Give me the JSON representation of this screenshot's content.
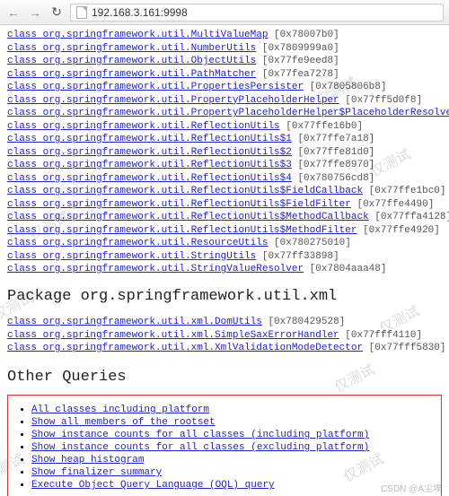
{
  "browser": {
    "url": "192.168.3.161:9998"
  },
  "classes": [
    {
      "name": "class org.springframework.util.MultiValueMap",
      "addr": "[0x78007b0]"
    },
    {
      "name": "class org.springframework.util.NumberUtils",
      "addr": "[0x7809999a0]"
    },
    {
      "name": "class org.springframework.util.ObjectUtils",
      "addr": "[0x77fe9eed8]"
    },
    {
      "name": "class org.springframework.util.PathMatcher",
      "addr": "[0x77fea7278]"
    },
    {
      "name": "class org.springframework.util.PropertiesPersister",
      "addr": "[0x7805806b8]"
    },
    {
      "name": "class org.springframework.util.PropertyPlaceholderHelper",
      "addr": "[0x77ff5d0f8]"
    },
    {
      "name": "class org.springframework.util.PropertyPlaceholderHelper$PlaceholderResolver",
      "addr": ""
    },
    {
      "name": "class org.springframework.util.ReflectionUtils",
      "addr": "[0x77ffe16b0]"
    },
    {
      "name": "class org.springframework.util.ReflectionUtils$1",
      "addr": "[0x77ffe7a18]"
    },
    {
      "name": "class org.springframework.util.ReflectionUtils$2",
      "addr": "[0x77ffe81d0]"
    },
    {
      "name": "class org.springframework.util.ReflectionUtils$3",
      "addr": "[0x77ffe8970]"
    },
    {
      "name": "class org.springframework.util.ReflectionUtils$4",
      "addr": "[0x780756cd8]"
    },
    {
      "name": "class org.springframework.util.ReflectionUtils$FieldCallback",
      "addr": "[0x77ffe1bc0]"
    },
    {
      "name": "class org.springframework.util.ReflectionUtils$FieldFilter",
      "addr": "[0x77ffe4490]"
    },
    {
      "name": "class org.springframework.util.ReflectionUtils$MethodCallback",
      "addr": "[0x77ffa4128]"
    },
    {
      "name": "class org.springframework.util.ReflectionUtils$MethodFilter",
      "addr": "[0x77ffe4920]"
    },
    {
      "name": "class org.springframework.util.ResourceUtils",
      "addr": "[0x780275010]"
    },
    {
      "name": "class org.springframework.util.StringUtils",
      "addr": "[0x77ff33898]"
    },
    {
      "name": "class org.springframework.util.StringValueResolver",
      "addr": "[0x7804aaa48]"
    }
  ],
  "package_xml": {
    "heading": "Package org.springframework.util.xml",
    "classes": [
      {
        "name": "class org.springframework.util.xml.DomUtils",
        "addr": "[0x780429528]"
      },
      {
        "name": "class org.springframework.util.xml.SimpleSaxErrorHandler",
        "addr": "[0x77fff4110]"
      },
      {
        "name": "class org.springframework.util.xml.XmlValidationModeDetector",
        "addr": "[0x77fff5830]"
      }
    ]
  },
  "other_queries": {
    "heading": "Other Queries",
    "items": [
      "All classes including platform",
      "Show all members of the rootset",
      "Show instance counts for all classes (including platform)",
      "Show instance counts for all classes (excluding platform)",
      "Show heap histogram",
      "Show finalizer summary",
      "Execute Object Query Language (OQL) query"
    ]
  },
  "watermark": "仅测试",
  "footer": "CSDN @A尘埃"
}
